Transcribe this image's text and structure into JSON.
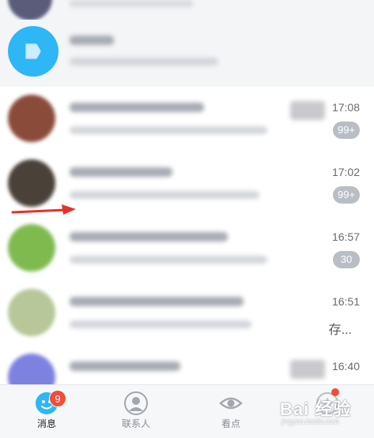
{
  "conversations": [
    {
      "time": "17:08",
      "badge": "99+",
      "avatar_color": "#8a4b3a"
    },
    {
      "time": "17:02",
      "badge": "99+",
      "avatar_color": "#4a4238"
    },
    {
      "time": "16:57",
      "badge": "30",
      "avatar_color": "#7fba4f"
    },
    {
      "time": "16:51",
      "right_text": "存...",
      "avatar_color": "#b7c79a"
    },
    {
      "time": "16:40",
      "avatar_color": "#7d82e0"
    }
  ],
  "tabbar": {
    "messages": {
      "label": "消息",
      "badge": "9"
    },
    "contacts": {
      "label": "联系人"
    },
    "watch": {
      "label": "看点"
    }
  },
  "watermark": {
    "text": "Bai 经验",
    "sub": "jingyan.baidu.com"
  },
  "colors": {
    "accent": "#2fb6f5",
    "badge_grey": "#b9bdc4",
    "badge_red": "#f04d3a",
    "arrow": "#e8302a"
  }
}
